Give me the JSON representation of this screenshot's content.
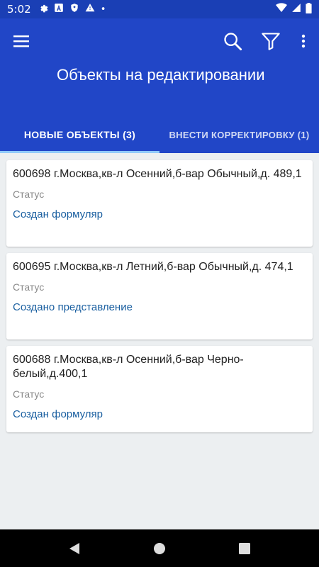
{
  "status_bar": {
    "time": "5:02",
    "icons_left": [
      "gear-icon",
      "a-icon",
      "shield-icon",
      "warning-icon",
      "dot-icon"
    ],
    "icons_right": [
      "wifi-icon",
      "signal-icon",
      "battery-icon"
    ]
  },
  "appbar": {
    "title": "Объекты на редактировании",
    "icons": [
      "menu-icon",
      "search-icon",
      "filter-icon",
      "more-vert-icon"
    ]
  },
  "tabs": [
    {
      "label": "НОВЫЕ ОБЪЕКТЫ (3)",
      "selected": true
    },
    {
      "label": "ВНЕСТИ КОРРЕКТИРОВКУ (1)",
      "selected": false
    }
  ],
  "items": [
    {
      "address": "600698 г.Москва,кв-л Осенний,б-вар Обычный,д. 489,1",
      "status_label": "Статус",
      "status_value": "Создан формуляр"
    },
    {
      "address": "600695 г.Москва,кв-л Летний,б-вар Обычный,д. 474,1",
      "status_label": "Статус",
      "status_value": "Создано представление"
    },
    {
      "address": "600688 г.Москва,кв-л Осенний,б-вар Черно-белый,д.400,1",
      "status_label": "Статус",
      "status_value": "Создан формуляр"
    }
  ],
  "colors": {
    "status_bar": "#1a3fb5",
    "appbar": "#2146c7",
    "tab_indicator": "#90caf9",
    "status_value": "#1a5fa0",
    "background": "#eceff1"
  },
  "navbar": {
    "icons": [
      "back-icon",
      "home-icon",
      "recents-icon"
    ]
  }
}
